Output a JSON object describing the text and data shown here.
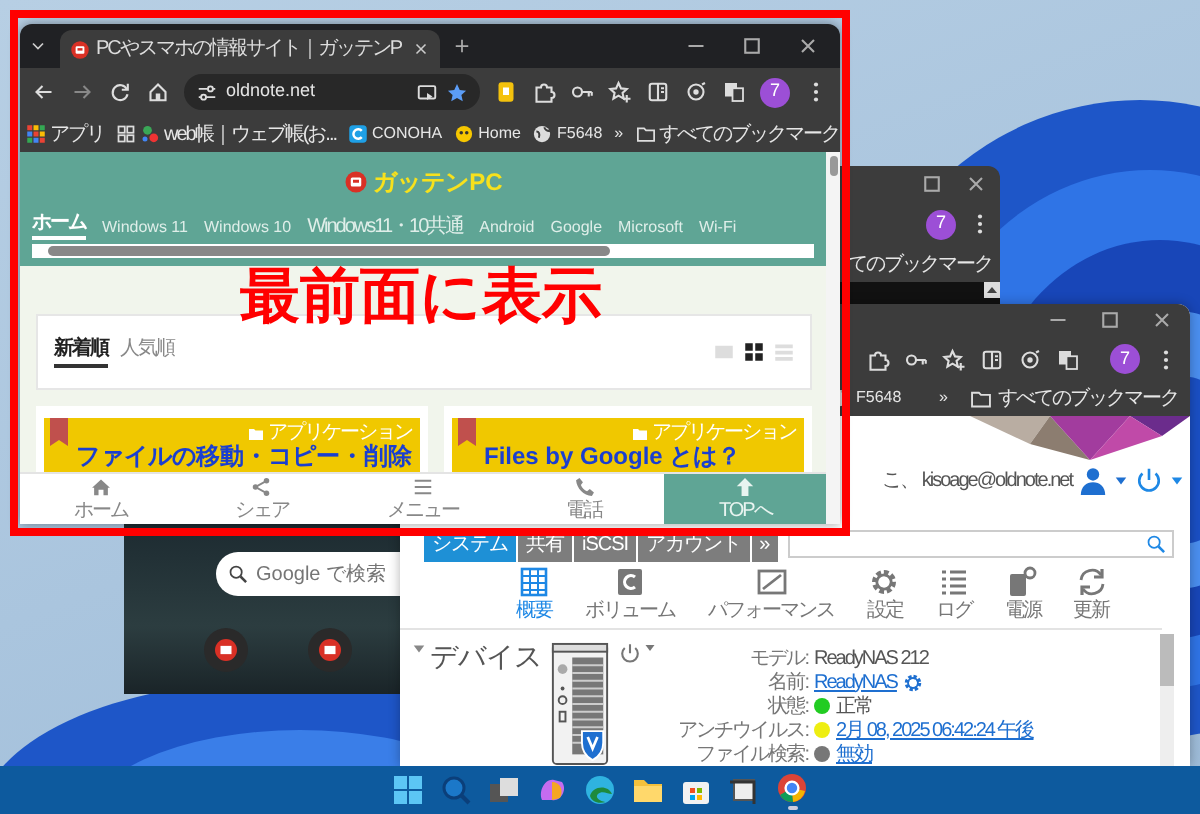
{
  "front_browser": {
    "tab_title": "PCやスマホの情報サイト｜ガッテンP",
    "url": "oldnote.net",
    "profile_initial": "7",
    "bookmarks": [
      {
        "label": "アプリ",
        "kind": "apps"
      },
      {
        "label": "web帳｜ウェブ帳(お...",
        "kind": "site"
      },
      {
        "label": "CONOHA",
        "kind": "conoha"
      },
      {
        "label": "Home",
        "kind": "home"
      },
      {
        "label": "F5648",
        "kind": "globe"
      }
    ],
    "bookmarks_more": "»",
    "all_bookmarks": "すべてのブックマーク",
    "page": {
      "logo": "ガッテンPC",
      "nav": [
        {
          "label": "ホーム",
          "selected": true
        },
        {
          "label": "Windows 11",
          "selected": false
        },
        {
          "label": "Windows 10",
          "selected": false
        },
        {
          "label": "Windows11・10共通",
          "selected": false
        },
        {
          "label": "Android",
          "selected": false
        },
        {
          "label": "Google",
          "selected": false
        },
        {
          "label": "Microsoft",
          "selected": false
        },
        {
          "label": "Wi-Fi",
          "selected": false
        }
      ],
      "sort_tabs": [
        {
          "label": "新着順",
          "selected": true
        },
        {
          "label": "人気順",
          "selected": false
        }
      ],
      "view_modes": [
        {
          "kind": "card",
          "selected": false
        },
        {
          "kind": "grid",
          "selected": true
        },
        {
          "kind": "list",
          "selected": false
        }
      ],
      "articles": [
        {
          "category": "アプリケーション",
          "title": "ファイルの移動・コピー・削除"
        },
        {
          "category": "アプリケーション",
          "title": "Files by Google とは？"
        }
      ],
      "bottom_bar": [
        {
          "label": "ホーム",
          "kind": "home"
        },
        {
          "label": "シェア",
          "kind": "share"
        },
        {
          "label": "メニュー",
          "kind": "menu"
        },
        {
          "label": "電話",
          "kind": "phone"
        },
        {
          "label": "TOPへ",
          "kind": "top"
        }
      ]
    }
  },
  "annotation": {
    "text": "最前面に表示"
  },
  "back_browser": {
    "profile_initial": "7",
    "all_bookmarks": "てのブックマーク"
  },
  "nas_browser": {
    "profile_initial": "7",
    "bookmarks": [
      {
        "label": "F5648",
        "kind": "globe"
      }
    ],
    "bookmarks_more": "»",
    "all_bookmarks": "すべてのブックマーク",
    "page": {
      "welcome": "こ、 kisoage@oldnote.net",
      "tabs": [
        {
          "label": "システム",
          "selected": true
        },
        {
          "label": "共有",
          "selected": false
        },
        {
          "label": "iSCSI",
          "selected": false
        },
        {
          "label": "アカウント",
          "selected": false
        },
        {
          "label": "»",
          "selected": false
        }
      ],
      "tools": [
        {
          "label": "概要",
          "kind": "overview",
          "selected": true
        },
        {
          "label": "ボリューム",
          "kind": "volume",
          "selected": false
        },
        {
          "label": "パフォーマンス",
          "kind": "performance",
          "selected": false
        },
        {
          "label": "設定",
          "kind": "settings",
          "selected": false
        },
        {
          "label": "ログ",
          "kind": "log",
          "selected": false
        },
        {
          "label": "電源",
          "kind": "power",
          "selected": false
        },
        {
          "label": "更新",
          "kind": "refresh",
          "selected": false
        }
      ],
      "section_title": "デバイス",
      "device_info": [
        {
          "label": "モデル:",
          "value": "ReadyNAS 212",
          "kind": "text"
        },
        {
          "label": "名前:",
          "value": "ReadyNAS",
          "kind": "link",
          "settings_icon": true
        },
        {
          "label": "状態:",
          "value": "正常",
          "kind": "text",
          "color": "#22cc22"
        },
        {
          "label": "アンチウイルス:",
          "value": "2月 08, 2025 06:42:24 午後",
          "kind": "link",
          "color": "#eeee11"
        },
        {
          "label": "ファイル検索:",
          "value": "無効",
          "kind": "link",
          "color": "#777777"
        }
      ]
    }
  },
  "google_window": {
    "search_placeholder": "Google で検索"
  },
  "taskbar": {
    "apps": [
      {
        "kind": "start",
        "running": false
      },
      {
        "kind": "search",
        "running": false
      },
      {
        "kind": "task_view",
        "running": false
      },
      {
        "kind": "copilot",
        "running": false
      },
      {
        "kind": "edge",
        "running": false
      },
      {
        "kind": "explorer",
        "running": false
      },
      {
        "kind": "store",
        "running": false
      },
      {
        "kind": "snipping",
        "running": false
      },
      {
        "kind": "chrome",
        "running": true
      }
    ]
  }
}
